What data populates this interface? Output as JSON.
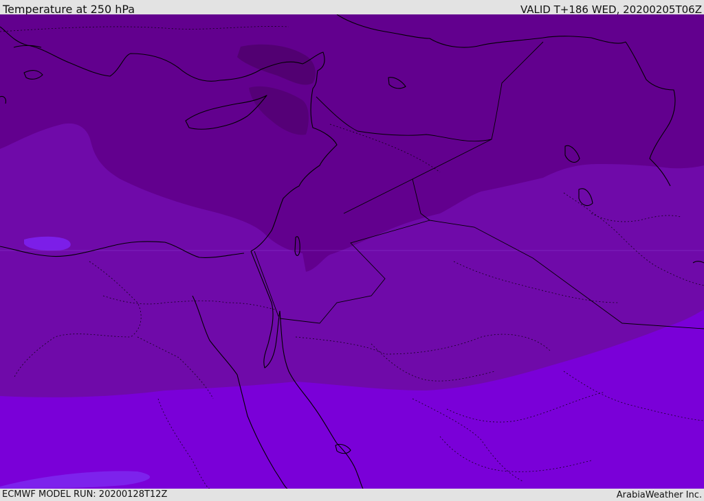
{
  "header": {
    "title": "Temperature at 250 hPa",
    "valid": "VALID T+186 WED, 20200205T06Z"
  },
  "footer": {
    "model_run": "ECMWF MODEL RUN: 20200128T12Z",
    "credit": "ArabiaWeather Inc."
  },
  "map": {
    "variable": "Temperature",
    "level": "250 hPa",
    "fill_colors": {
      "darkest": "#520072",
      "dark": "#62008e",
      "medium": "#6f0aa9",
      "bright": "#7a00d8",
      "light_spot": "#7c1ee8"
    },
    "border_color": "#000000"
  }
}
